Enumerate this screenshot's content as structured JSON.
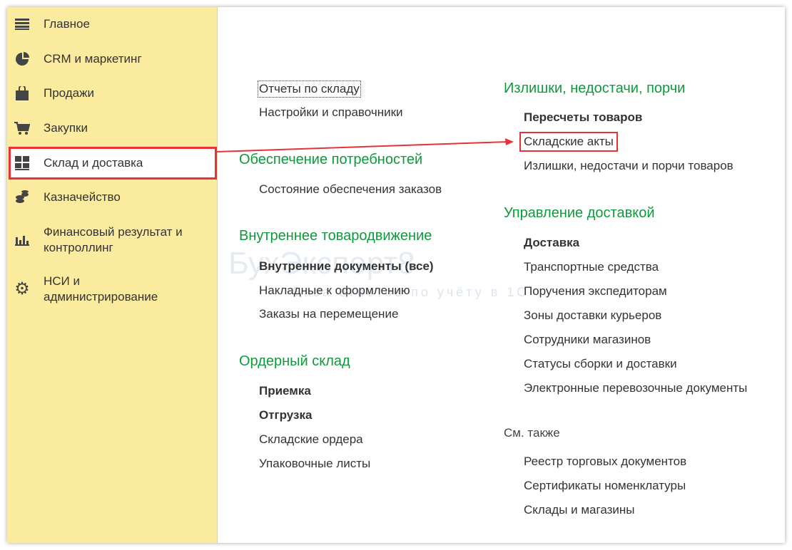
{
  "sidebar": {
    "items": [
      {
        "label": "Главное",
        "icon": "menu-icon"
      },
      {
        "label": "CRM и маркетинг",
        "icon": "pie-chart-icon"
      },
      {
        "label": "Продажи",
        "icon": "shopping-bag-icon"
      },
      {
        "label": "Закупки",
        "icon": "cart-icon"
      },
      {
        "label": "Склад и доставка",
        "icon": "warehouse-grid-icon",
        "selected": true
      },
      {
        "label": "Казначейство",
        "icon": "coins-icon"
      },
      {
        "label": "Финансовый результат и контроллинг",
        "icon": "bar-chart-icon"
      },
      {
        "label": "НСИ и администрирование",
        "icon": "gear-icon"
      }
    ]
  },
  "col1": {
    "top": [
      "Отчеты по складу",
      "Настройки и справочники"
    ],
    "s1": {
      "title": "Обеспечение потребностей",
      "links": [
        "Состояние обеспечения заказов"
      ]
    },
    "s2": {
      "title": "Внутреннее товародвижение",
      "links": [
        "Внутренние документы (все)",
        "Накладные к оформлению",
        "Заказы на перемещение"
      ]
    },
    "s3": {
      "title": "Ордерный склад",
      "links": [
        "Приемка",
        "Отгрузка",
        "Складские ордера",
        "Упаковочные листы"
      ]
    }
  },
  "col2": {
    "s1": {
      "title": "Излишки, недостачи, порчи",
      "links": [
        "Пересчеты товаров",
        "Складские акты",
        "Излишки, недостачи и порчи товаров"
      ]
    },
    "s2": {
      "title": "Управление доставкой",
      "links": [
        "Доставка",
        "Транспортные средства",
        "Поручения экспедиторам",
        "Зоны доставки курьеров",
        "Сотрудники магазинов",
        "Статусы сборки и доставки",
        "Электронные перевозочные документы"
      ]
    },
    "see_also": {
      "title": "См. также",
      "links": [
        "Реестр торговых документов",
        "Сертификаты номенклатуры",
        "Склады и магазины"
      ]
    }
  },
  "watermark": {
    "title": "БухЭксперт8",
    "subtitle": "База ответов по учёту в 1С"
  },
  "colors": {
    "accent": "#0d9a3c",
    "highlight": "#e8323a",
    "sidebar": "#fbeb9f"
  }
}
